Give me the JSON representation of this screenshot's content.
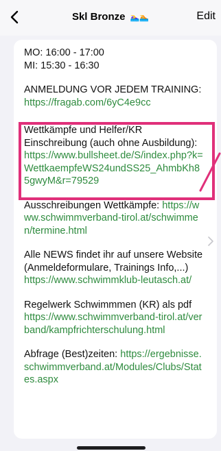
{
  "nav": {
    "back_icon": "chevron-left-icon",
    "title": "Skl Bronze",
    "title_emoji": "🏊‍♀️🏊",
    "edit_label": "Edit"
  },
  "blocks": [
    {
      "lines": [
        "MO: 16:00 - 17:00",
        "MI: 15:30 - 16:30"
      ]
    },
    {
      "text": "ANMELDUNG VOR JEDEM TRAINING:",
      "link": "https://fragab.com/6yC4e9cc"
    },
    {
      "text": "Wettkämpfe und Helfer/KR Einschreibung (auch ohne Ausbildung):",
      "link": "https://www.bullsheet.de/S/index.php?k=WettkaempfeWS24undSS25_AhmbKh85gwyM&r=79529"
    },
    {
      "text": "Ausschreibungen Wettkämpfe:",
      "link": "https://www.schwimmverband-tirol.at/schwimmen/termine.html"
    },
    {
      "text": "Alle NEWS findet ihr auf unsere Website (Anmeldeformulare, Trainings Info,...)",
      "link": "https://www.schwimmklub-leutasch.at/"
    },
    {
      "text": "Regelwerk Schwimmmen (KR) als pdf",
      "link": "https://www.schwimmverband-tirol.at/verband/kampfrichterschulung.html"
    },
    {
      "text": "Abfrage (Best)zeiten:",
      "link": "https://ergebnisse.schwimmverband.at/Modules/Clubs/States.aspx"
    }
  ],
  "colors": {
    "link": "#2e8b3e",
    "highlight": "#e0307a"
  }
}
